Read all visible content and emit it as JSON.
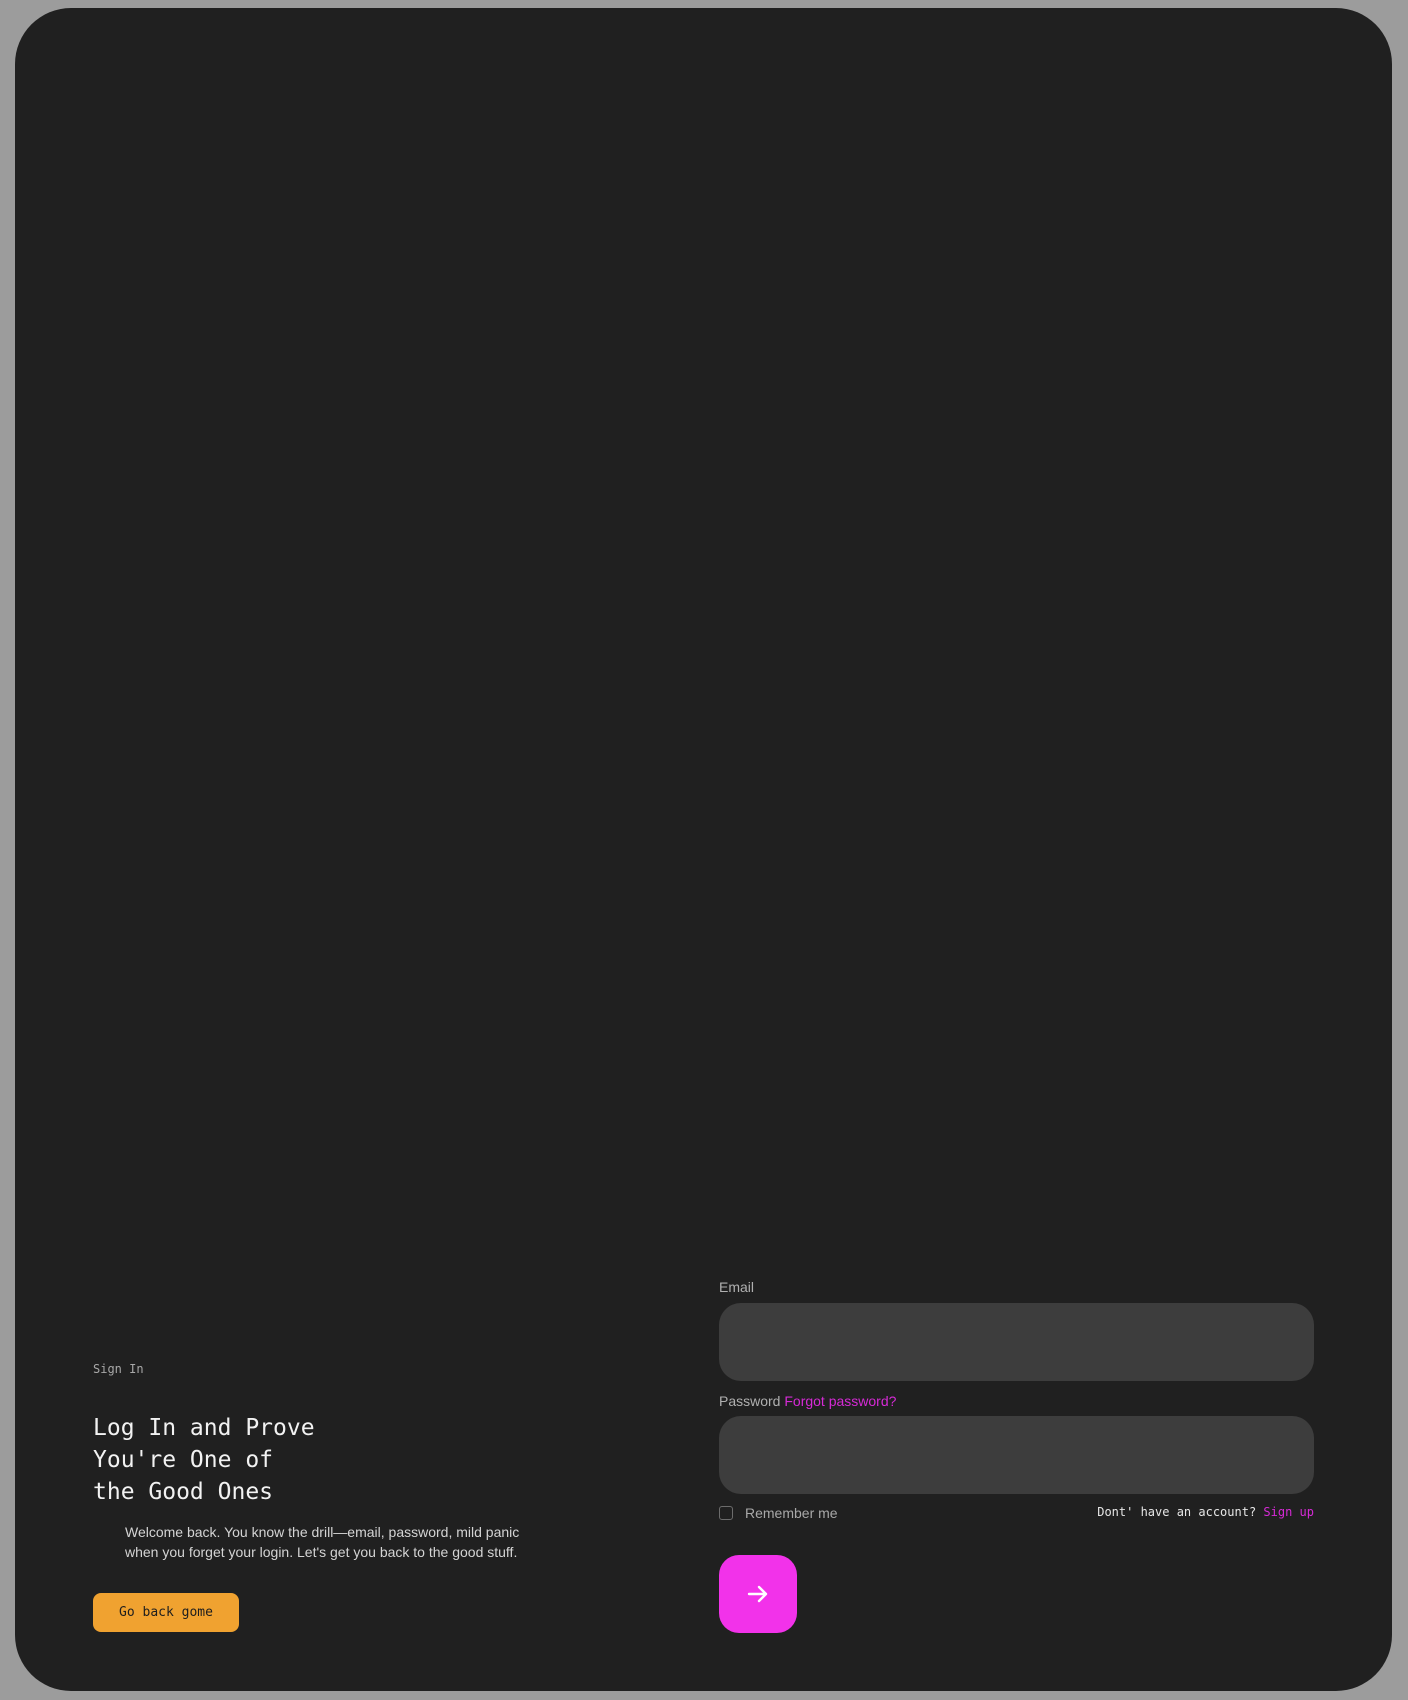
{
  "intro": {
    "eyebrow": "Sign In",
    "headline_lines": [
      "Log In and Prove",
      "You're One of",
      "the Good Ones"
    ],
    "description_lines": [
      "Welcome back. You know the drill—email, password, mild panic",
      "when you forget your login. Let's get you back to the good stuff."
    ],
    "home_button_label": "Go back gome"
  },
  "form": {
    "email_label": "Email",
    "email_value": "",
    "password_label": "Password",
    "forgot_password_label": "Forgot password?",
    "password_value": "",
    "remember_label": "Remember me",
    "remember_checked": false,
    "signup_prompt": "Dont' have an account?",
    "signup_link": "Sign up",
    "submit_icon": "arrow-right-icon"
  },
  "colors": {
    "page_background": "#9c9c9c",
    "card_background": "#202020",
    "input_background": "#3d3d3d",
    "accent_magenta": "#f232ea",
    "link_magenta": "#d62ad6",
    "home_button_orange": "#f0a230"
  }
}
